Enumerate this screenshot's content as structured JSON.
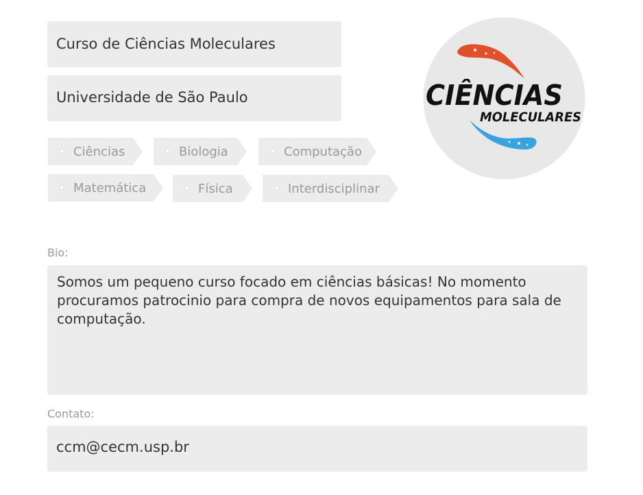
{
  "profile": {
    "course_name": "Curso de Ciências Moleculares",
    "university": "Universidade de São Paulo"
  },
  "tags": [
    {
      "label": "Ciências"
    },
    {
      "label": "Biologia"
    },
    {
      "label": "Computação"
    },
    {
      "label": "Matemática"
    },
    {
      "label": "Física"
    },
    {
      "label": "Interdisciplinar"
    }
  ],
  "bio": {
    "label": "Bio:",
    "value": "Somos um pequeno curso focado em ciências básicas! No momento procuramos patrocinio para compra de novos equipamentos para sala de computação."
  },
  "contact": {
    "label": "Contato:",
    "value": "ccm@cecm.usp.br"
  },
  "logo": {
    "line1": "CIÊNCIAS",
    "line2": "MOLECULARES",
    "colors": {
      "circle": "#e8e8e8",
      "swoosh_top": "#e0502a",
      "swoosh_bottom": "#3aa3dd",
      "text": "#111111"
    }
  }
}
